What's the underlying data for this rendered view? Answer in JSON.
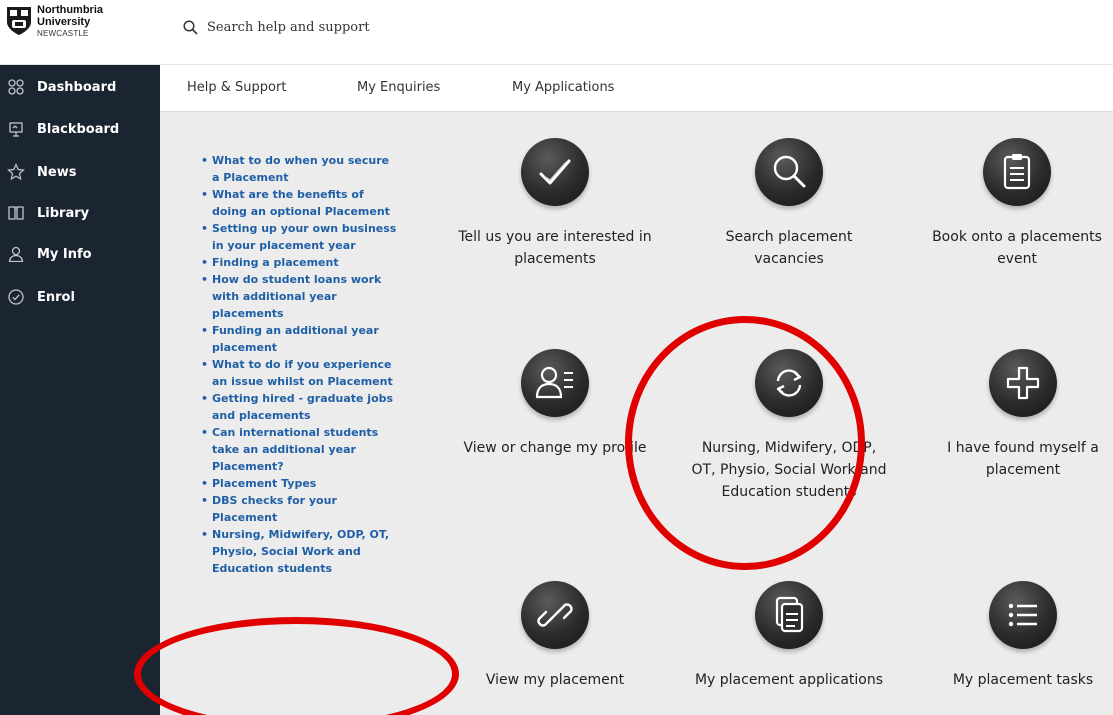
{
  "header": {
    "logo_line1": "Northumbria",
    "logo_line2": "University",
    "logo_line3": "NEWCASTLE",
    "search_placeholder": "Search help and support"
  },
  "sidebar": {
    "items": [
      {
        "label": "Dashboard",
        "icon": "grid-icon"
      },
      {
        "label": "Blackboard",
        "icon": "presentation-icon"
      },
      {
        "label": "News",
        "icon": "star-icon"
      },
      {
        "label": "Library",
        "icon": "book-icon"
      },
      {
        "label": "My Info",
        "icon": "user-icon"
      },
      {
        "label": "Enrol",
        "icon": "check-circle-icon"
      }
    ]
  },
  "tabs": [
    "Help & Support",
    "My Enquiries",
    "My Applications"
  ],
  "links": [
    "What to do when you secure a Placement",
    "What are the benefits of doing an optional Placement",
    "Setting up your own business in your placement year",
    "Finding a placement",
    "How do student loans work with additional year placements",
    "Funding an additional year placement",
    "What to do if you experience an issue whilst on Placement",
    "Getting hired - graduate jobs and placements",
    "Can international students take an additional year Placement?",
    "Placement Types",
    "DBS checks for your Placement",
    "Nursing, Midwifery, ODP, OT, Physio, Social Work and Education students"
  ],
  "tiles": [
    {
      "label": "Tell us you are interested in placements",
      "icon": "checkmark-icon"
    },
    {
      "label": "Search placement vacancies",
      "icon": "magnifier-icon"
    },
    {
      "label": "Book onto a placements event",
      "icon": "clipboard-icon"
    },
    {
      "label": "View or change my profile",
      "icon": "profile-icon"
    },
    {
      "label": "Nursing, Midwifery, ODP, OT, Physio, Social Work and Education students",
      "icon": "refresh-icon"
    },
    {
      "label": "I have found myself a placement",
      "icon": "plus-icon"
    },
    {
      "label": "View my placement",
      "icon": "link-icon"
    },
    {
      "label": "My placement applications",
      "icon": "documents-icon"
    },
    {
      "label": "My placement tasks",
      "icon": "list-icon"
    }
  ],
  "colors": {
    "sidebar_bg": "#1b2431",
    "link": "#1f5fa6",
    "annotation": "#e00000"
  }
}
